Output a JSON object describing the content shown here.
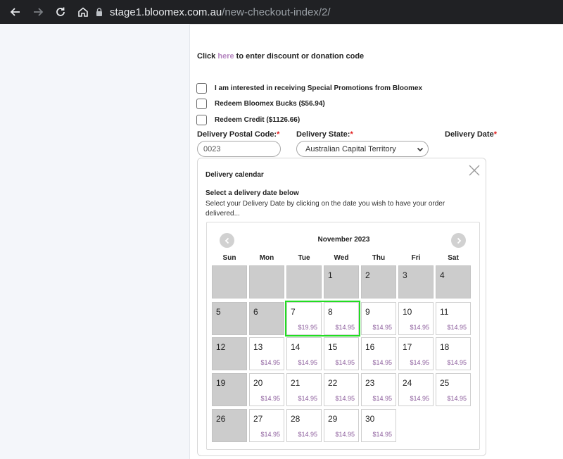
{
  "browser": {
    "url_host": "stage1.bloomex.com.au",
    "url_path": "/new-checkout-index/2/"
  },
  "checkout": {
    "discount_prefix": "Click ",
    "discount_link": "here",
    "discount_suffix": " to enter discount or donation code",
    "checkboxes": [
      {
        "label": "I am interested in receiving Special Promotions from Bloomex",
        "checked": false
      },
      {
        "label": "Redeem Bloomex Bucks ($56.94)",
        "checked": false
      },
      {
        "label": "Redeem Credit ($1126.66)",
        "checked": false
      }
    ],
    "postal_label": "Delivery Postal Code:",
    "postal_value": "0023",
    "state_label": "Delivery State:",
    "state_value": "Australian Capital Territory",
    "date_label": "Delivery Date",
    "required_mark": "*"
  },
  "calendar": {
    "title": "Delivery calendar",
    "subtitle": "Select a delivery date below",
    "description": "Select your Delivery Date by clicking on the date you wish to have your order delivered...",
    "month": "November 2023",
    "weekdays": [
      "Sun",
      "Mon",
      "Tue",
      "Wed",
      "Thu",
      "Fri",
      "Sat"
    ],
    "weeks": [
      [
        {
          "day": "",
          "price": "",
          "disabled": true
        },
        {
          "day": "",
          "price": "",
          "disabled": true
        },
        {
          "day": "",
          "price": "",
          "disabled": true
        },
        {
          "day": "1",
          "price": "",
          "disabled": true
        },
        {
          "day": "2",
          "price": "",
          "disabled": true
        },
        {
          "day": "3",
          "price": "",
          "disabled": true
        },
        {
          "day": "4",
          "price": "",
          "disabled": true
        }
      ],
      [
        {
          "day": "5",
          "price": "",
          "disabled": true
        },
        {
          "day": "6",
          "price": "",
          "disabled": true
        },
        {
          "day": "7",
          "price": "$19.95",
          "disabled": false,
          "selected": true
        },
        {
          "day": "8",
          "price": "$14.95",
          "disabled": false,
          "selected": true
        },
        {
          "day": "9",
          "price": "$14.95",
          "disabled": false
        },
        {
          "day": "10",
          "price": "$14.95",
          "disabled": false
        },
        {
          "day": "11",
          "price": "$14.95",
          "disabled": false
        }
      ],
      [
        {
          "day": "12",
          "price": "",
          "disabled": true
        },
        {
          "day": "13",
          "price": "$14.95",
          "disabled": false
        },
        {
          "day": "14",
          "price": "$14.95",
          "disabled": false
        },
        {
          "day": "15",
          "price": "$14.95",
          "disabled": false
        },
        {
          "day": "16",
          "price": "$14.95",
          "disabled": false
        },
        {
          "day": "17",
          "price": "$14.95",
          "disabled": false
        },
        {
          "day": "18",
          "price": "$14.95",
          "disabled": false
        }
      ],
      [
        {
          "day": "19",
          "price": "",
          "disabled": true
        },
        {
          "day": "20",
          "price": "$14.95",
          "disabled": false
        },
        {
          "day": "21",
          "price": "$14.95",
          "disabled": false
        },
        {
          "day": "22",
          "price": "$14.95",
          "disabled": false
        },
        {
          "day": "23",
          "price": "$14.95",
          "disabled": false
        },
        {
          "day": "24",
          "price": "$14.95",
          "disabled": false
        },
        {
          "day": "25",
          "price": "$14.95",
          "disabled": false
        }
      ],
      [
        {
          "day": "26",
          "price": "",
          "disabled": true
        },
        {
          "day": "27",
          "price": "$14.95",
          "disabled": false
        },
        {
          "day": "28",
          "price": "$14.95",
          "disabled": false
        },
        {
          "day": "29",
          "price": "$14.95",
          "disabled": false
        },
        {
          "day": "30",
          "price": "$14.95",
          "disabled": false
        }
      ]
    ]
  },
  "colors": {
    "selected_border": "#22dd22",
    "disabled_cell": "#cccccc",
    "price_text": "#8a5a9a",
    "link": "#b586c0",
    "required": "#e11d1d"
  }
}
